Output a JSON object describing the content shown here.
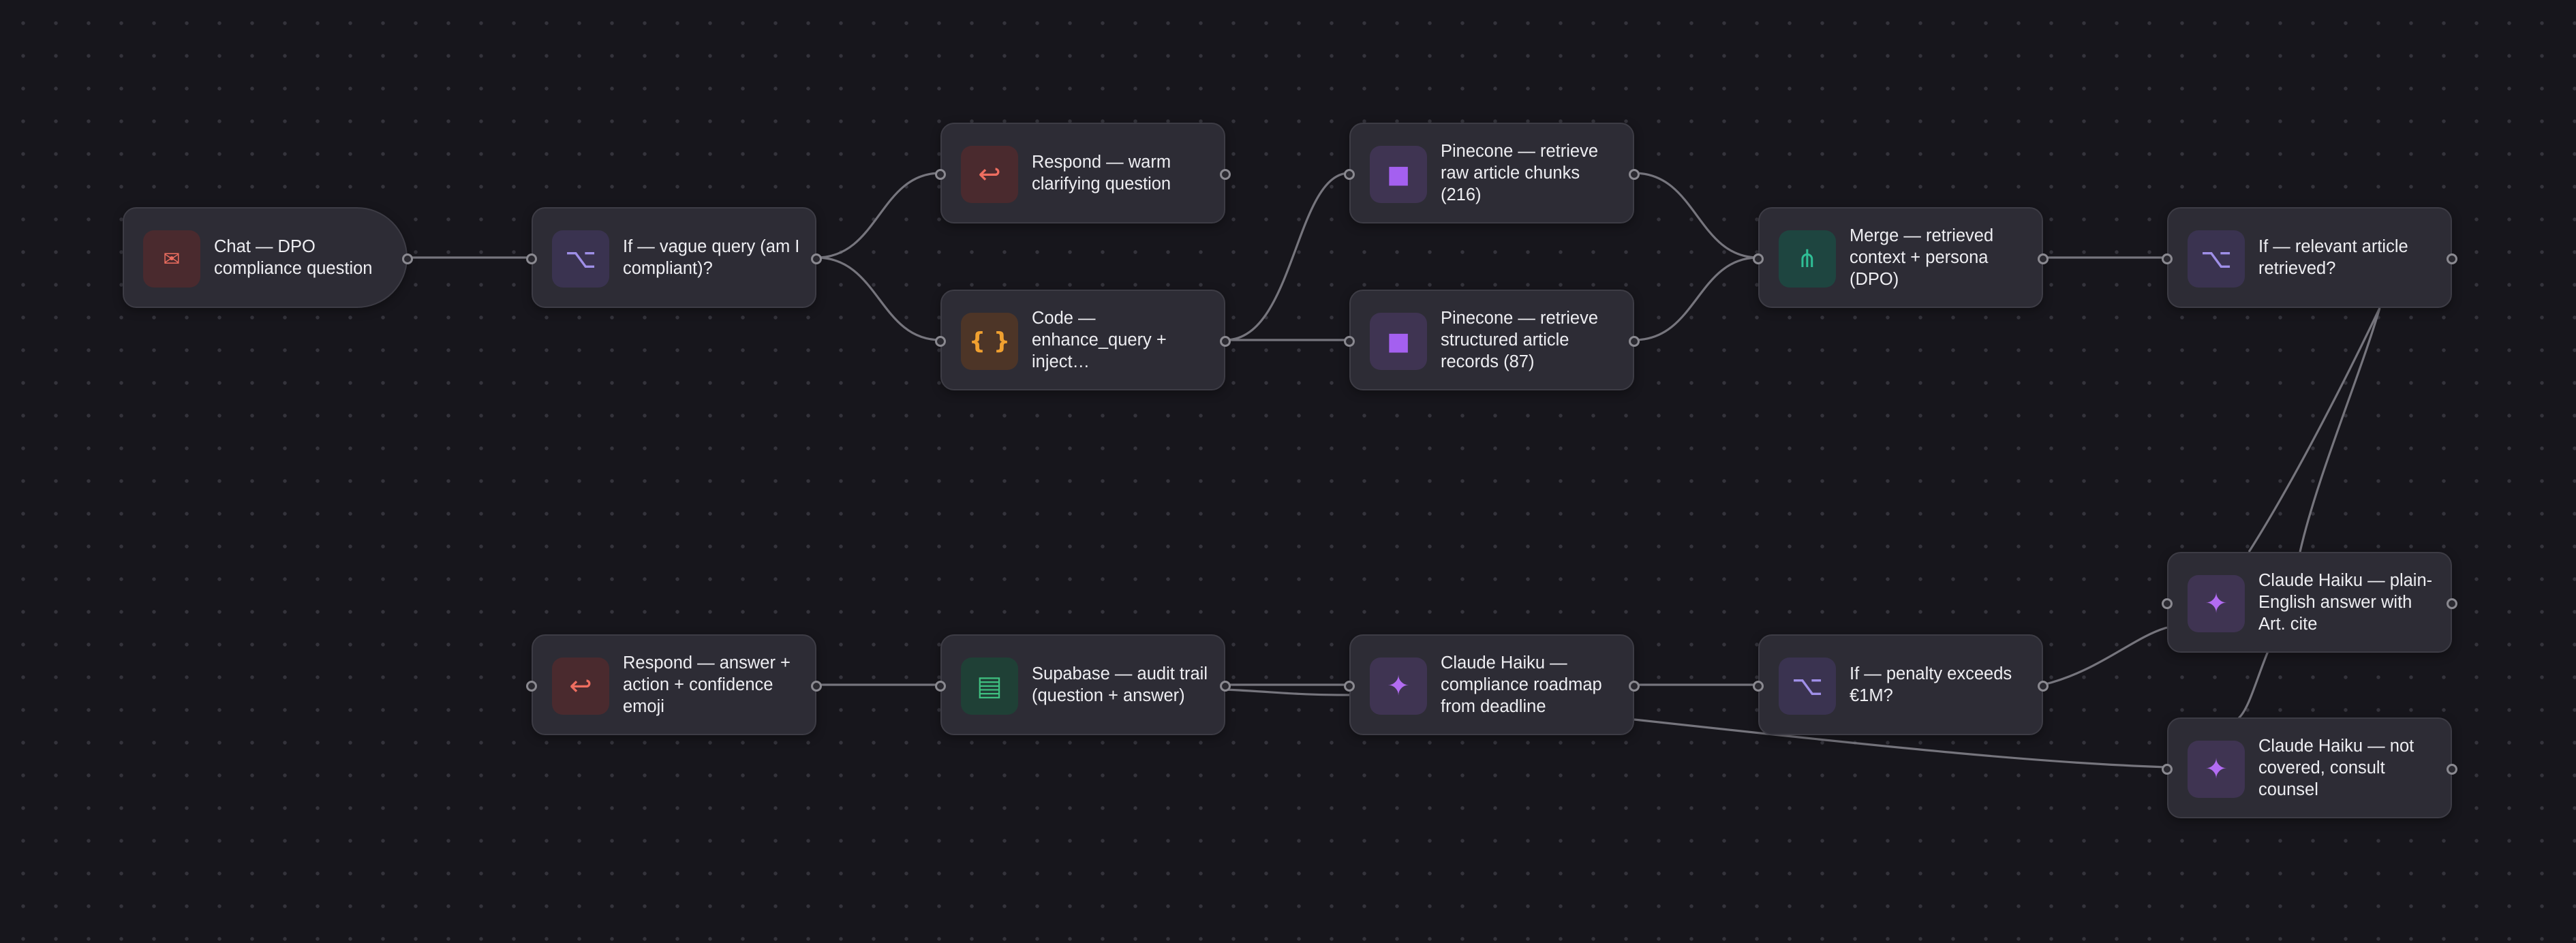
{
  "canvas": {
    "title": ""
  },
  "colors": {
    "background": "#17161c",
    "node_background": "#2d2c35",
    "edge": "#76757d",
    "trigger_accent": "#ee6e60",
    "if_accent": "#9f8fe8",
    "code_accent": "#f0a030",
    "pinecone_accent": "#a460f0",
    "merge_accent": "#2fbf96",
    "supabase_accent": "#3fc080",
    "claude_accent": "#b26cf2"
  },
  "nodes": {
    "chat_trigger": {
      "label": "Chat — DPO compliance question",
      "icon": "envelope-icon",
      "glyph": "✉"
    },
    "if_vague": {
      "label": "If — vague query (am I compliant)?",
      "icon": "branch-icon",
      "glyph": "⌥"
    },
    "respond_clarify": {
      "label": "Respond — warm clarifying question",
      "icon": "reply-icon",
      "glyph": "↩"
    },
    "code_enhance": {
      "label": "Code — enhance_query + inject…",
      "icon": "code-braces-icon",
      "glyph": "{ }"
    },
    "pinecone_raw": {
      "label": "Pinecone — retrieve raw article chunks (216)",
      "icon": "pinecone-square-icon",
      "glyph": "■"
    },
    "pinecone_structured": {
      "label": "Pinecone — retrieve structured article records (87)",
      "icon": "pinecone-square-icon",
      "glyph": "■"
    },
    "merge_context": {
      "label": "Merge — retrieved context + persona (DPO)",
      "icon": "merge-icon",
      "glyph": "⋔"
    },
    "if_relevant": {
      "label": "If — relevant article retrieved?",
      "icon": "branch-icon",
      "glyph": "⌥"
    },
    "claude_plain": {
      "label": "Claude Haiku — plain-English answer with Art. cite",
      "icon": "sparkle-icon",
      "glyph": "✦"
    },
    "claude_not_covered": {
      "label": "Claude Haiku — not covered, consult counsel",
      "icon": "sparkle-icon",
      "glyph": "✦"
    },
    "if_penalty": {
      "label": "If — penalty exceeds €1M?",
      "icon": "branch-icon",
      "glyph": "⌥"
    },
    "claude_roadmap": {
      "label": "Claude Haiku — compliance roadmap from deadline",
      "icon": "sparkle-icon",
      "glyph": "✦"
    },
    "supabase_audit": {
      "label": "Supabase — audit trail (question + answer)",
      "icon": "table-icon",
      "glyph": "▤"
    },
    "respond_answer": {
      "label": "Respond — answer + action + confidence emoji",
      "icon": "reply-icon",
      "glyph": "↩"
    }
  }
}
